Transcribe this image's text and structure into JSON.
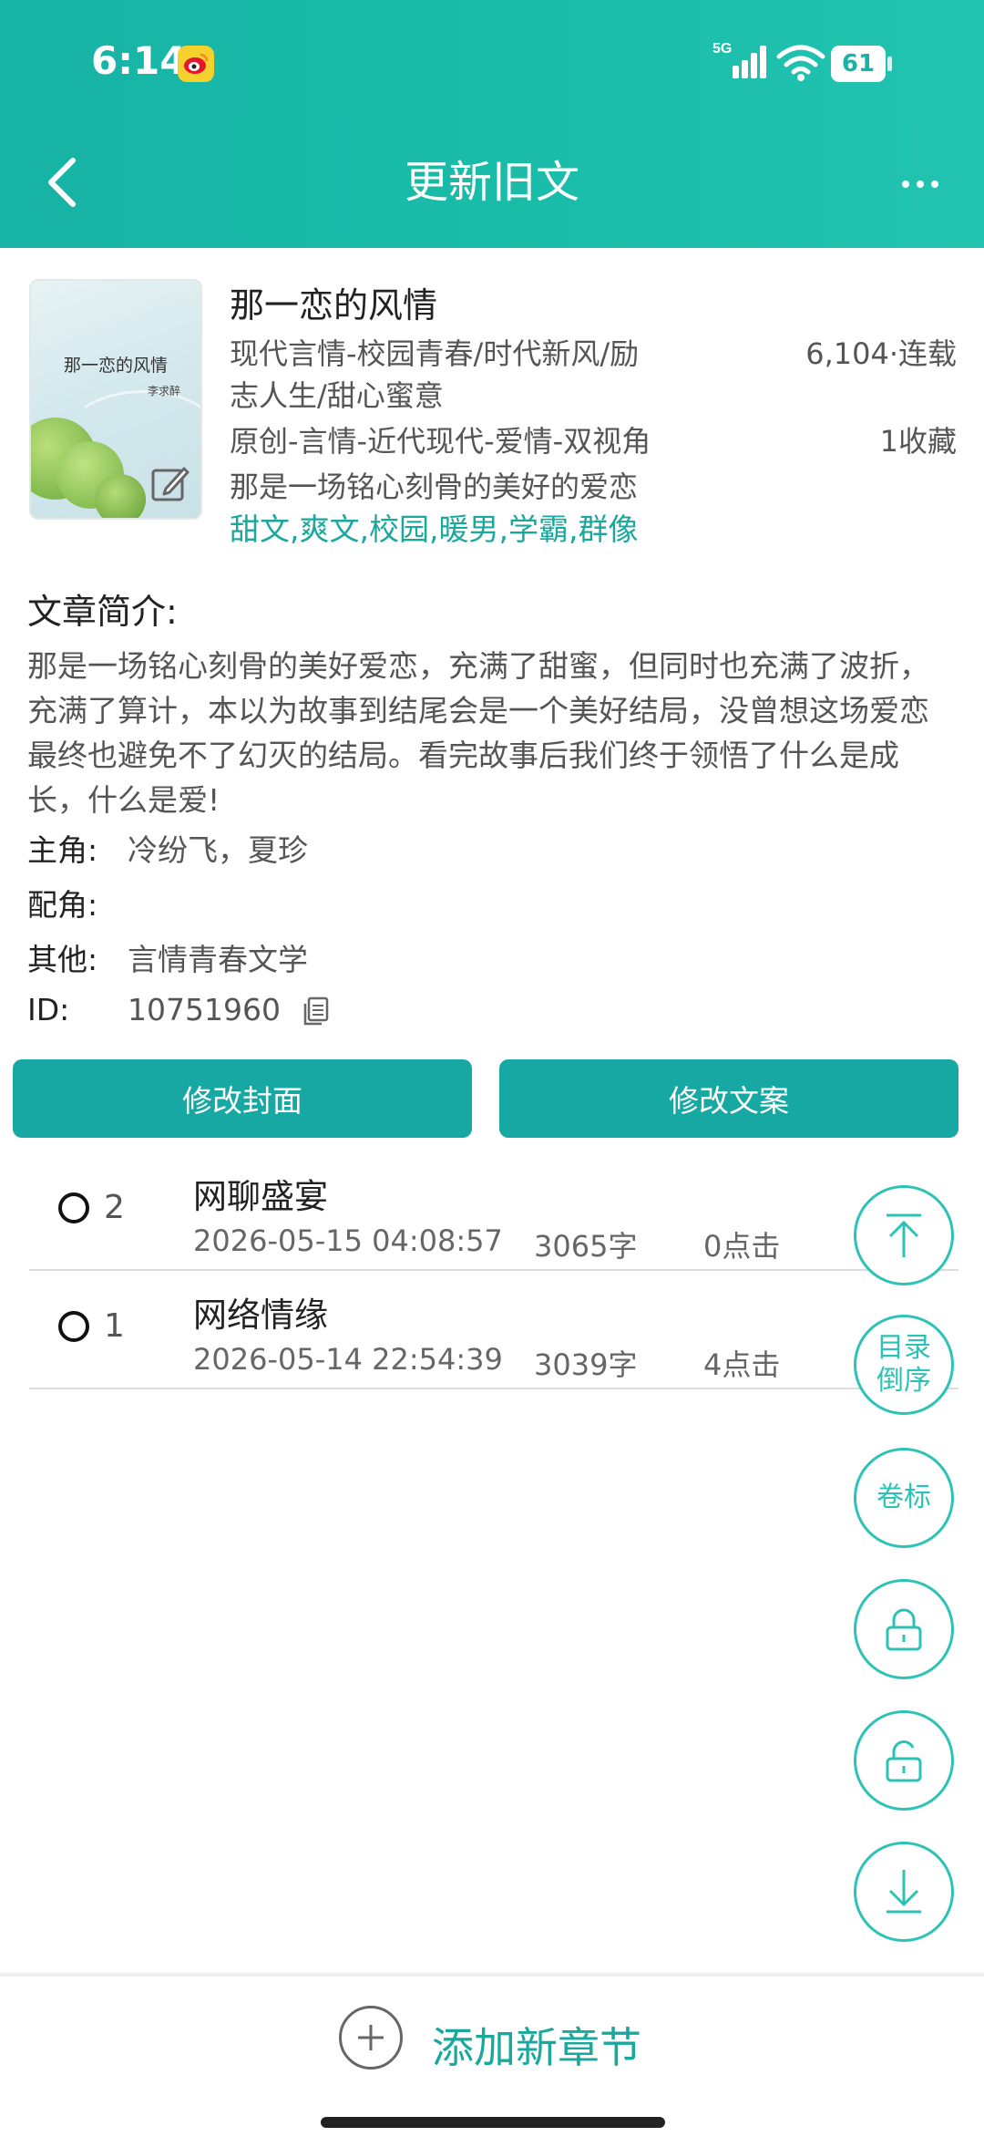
{
  "status": {
    "time": "6:14",
    "network": "5G",
    "battery": "61"
  },
  "header": {
    "title": "更新旧文",
    "more": "···"
  },
  "book": {
    "name": "那一恋的风情",
    "cover_title": "那一恋的风情",
    "cover_author": "李求醉",
    "genre_line1": "现代言情-校园青春/时代新风/励",
    "genre_line2": "志人生/甜心蜜意",
    "word_status": "6,104·连载",
    "category": "原创-言情-近代现代-爱情-双视角",
    "favorites": "1收藏",
    "tagline": "那是一场铭心刻骨的美好的爱恋",
    "tags": "甜文,爽文,校园,暖男,学霸,群像"
  },
  "summary": {
    "title": "文章简介:",
    "lines": [
      "那是一场铭心刻骨的美好爱恋，充满了甜蜜，但同时也充满了波折，",
      "充满了算计，本以为故事到结尾会是一个美好结局，没曾想这场爱恋",
      "最终也避免不了幻灭的结局。看完故事后我们终于领悟了什么是成",
      "长，什么是爱!"
    ]
  },
  "info": {
    "lead_label": "主角:",
    "lead_value": "冷纷飞，夏珍",
    "support_label": "配角:",
    "support_value": "",
    "other_label": "其他:",
    "other_value": "言情青春文学",
    "id_label": "ID:",
    "id_value": "10751960"
  },
  "buttons": {
    "cover": "修改封面",
    "copy": "修改文案"
  },
  "chapters": [
    {
      "num": "2",
      "title": "网聊盛宴",
      "date": "2026-05-15 04:08:57",
      "words": "3065字",
      "clicks": "0点击"
    },
    {
      "num": "1",
      "title": "网络情缘",
      "date": "2026-05-14 22:54:39",
      "words": "3039字",
      "clicks": "4点击"
    }
  ],
  "fabs": {
    "reverse": "目录\n倒序",
    "volume": "卷标"
  },
  "footer": {
    "add_chapter": "添加新章节"
  },
  "colors": {
    "accent": "#17a8a3",
    "header": "#19bca8",
    "tag": "#1aa89c"
  }
}
